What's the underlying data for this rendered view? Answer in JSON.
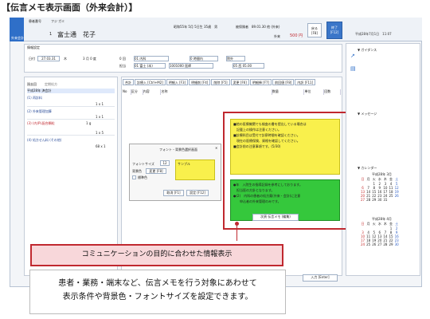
{
  "page_title": "【伝言メモ表示画面（外来会計）】",
  "header": {
    "logo_label": "外来会計",
    "patient_label": "患者番号",
    "patient_kana": "フジ ガミ",
    "patient_id": "1",
    "patient_name": "富士通　花子",
    "birth_info": "昭和55年 5月 5日生 35歳　男",
    "insurance_info": "被保険者　89.01.30 他 (外来)",
    "visit_label": "外来",
    "amount": "500 円",
    "btn_prev": "戻る\n[F8]",
    "btn_end": "終了\n[F12]",
    "datetime": "平成28年7月1日　11:07"
  },
  "form": {
    "section_label": "情報設定",
    "date_label": "日付",
    "date_value": "27.03.31",
    "dow": "木",
    "count_label": "3 月 0 度",
    "count2": "0 回",
    "select1": "01 内科",
    "select2": "0 時間内",
    "select3": "院外",
    "doctor_label": "担当",
    "doctor_value": "01 富士 (本)",
    "dept_code": "1001000 医師",
    "ymd": "05 西 05.00"
  },
  "left_list": {
    "tab1": "過去回",
    "tab2": "定期処方",
    "item0": "平成28年 済会計",
    "items": [
      {
        "label": "(1) 再診料",
        "qty": "1 x 1",
        "amount": ""
      },
      {
        "label": "(2) 外来管理加算",
        "qty": "1 x 1",
        "amount": ""
      },
      {
        "label": "(3) (内)PL配合顆粒",
        "qty": "1 x 5",
        "amount": "1 g"
      },
      {
        "label": "(4) 処方せん料 (その他)",
        "qty": "68 x 1",
        "amount": ""
      }
    ]
  },
  "tabs": [
    "合計",
    "診療入 [Ctrl+M2]",
    "明細入 [F3]",
    "明細削 [F4]",
    "削除 [F5]",
    "変更 [F6]",
    "明細挿 [F7]",
    "前回値 [F8]",
    "内訳 [F11]"
  ],
  "table_headers": [
    "No",
    "区分",
    "内容",
    "名称",
    "数量",
    "単位",
    "回数"
  ],
  "font_dialog": {
    "title": "フォント・背景色選択画面",
    "font_size_label": "フォントサイズ",
    "font_size_value": "12",
    "bg_label": "背景色",
    "change_btn": "変更 [F8]",
    "standard_label": "標準色",
    "sample": "サンプル",
    "cancel_btn": "取消 [F1]",
    "ok_btn": "設定 [F12]"
  },
  "memo_yellow": [
    "■他の医療機関でも検査の書を提出している場合は",
    "　記載上の操作は注意ください。",
    "■診療科目は受付で診察時間を確認ください。",
    "　現在の医療保険、資格を確認してください。",
    "■会計前の注意事項です。(5/30)"
  ],
  "memo_green": [
    "●年　入院生の指導記録を参考にしております。",
    "　担当医の方針となります。",
    "●(2)　内科の患者の処方薬(外来・会計)に注意",
    "　　申込者の外来管理のみです。"
  ],
  "memo_btn": "次頁 伝言メモ (編集)",
  "right_panel": {
    "guide_title": "▼ ガイダンス",
    "message_title": "▼ メッセージ",
    "calendar_title": "▼ カレンダー",
    "cal1_title": "平成28年 3月",
    "cal2_title": "平成28年 4月",
    "weekdays": [
      "日",
      "月",
      "火",
      "水",
      "木",
      "金",
      "土"
    ],
    "cal1_rows": [
      [
        "",
        "",
        "1",
        "2",
        "3",
        "4",
        "5"
      ],
      [
        "6",
        "7",
        "8",
        "9",
        "10",
        "11",
        "12"
      ],
      [
        "13",
        "14",
        "15",
        "16",
        "17",
        "18",
        "19"
      ],
      [
        "20",
        "21",
        "22",
        "23",
        "24",
        "25",
        "26"
      ],
      [
        "27",
        "28",
        "29",
        "30",
        "31",
        "",
        ""
      ]
    ],
    "cal2_rows": [
      [
        "",
        "",
        "",
        "",
        "",
        "1",
        "2"
      ],
      [
        "3",
        "4",
        "5",
        "6",
        "7",
        "8",
        "9"
      ],
      [
        "10",
        "11",
        "12",
        "13",
        "14",
        "15",
        "16"
      ],
      [
        "17",
        "18",
        "19",
        "20",
        "21",
        "22",
        "23"
      ],
      [
        "24",
        "25",
        "26",
        "27",
        "28",
        "29",
        "30"
      ]
    ]
  },
  "footer": {
    "input_btn": "入力 [Enter]"
  },
  "banner_text": "コミュニケーションの目的に合わせた情報表示",
  "desc_line1": "患者・業務・端末など、伝言メモを行う対象にあわせて",
  "desc_line2": "表示条件や背景色・フォントサイズを設定できます。",
  "colors": {
    "accent": "#c0282f",
    "brand": "#2f6fc8",
    "memo_yellow": "#f9f04c",
    "memo_green": "#35c83c"
  }
}
